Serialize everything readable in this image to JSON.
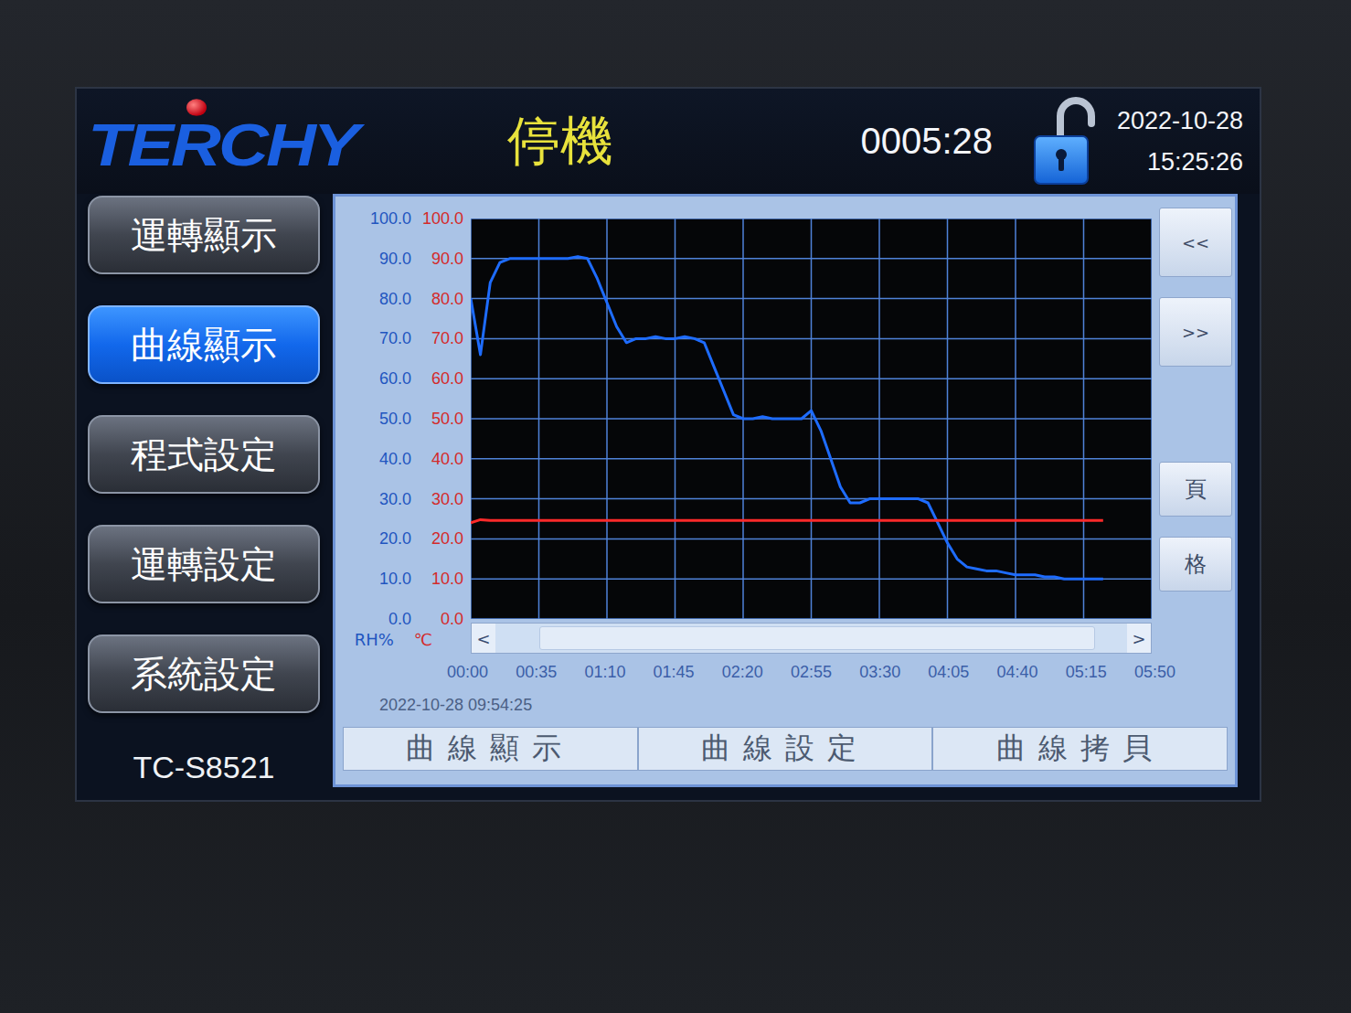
{
  "header": {
    "logo": "TERCHY",
    "status": "停機",
    "timer": "0005:28",
    "lock": {
      "locked": false
    },
    "date": "2022-10-28",
    "time": "15:25:26"
  },
  "sidebar": {
    "items": [
      {
        "label": "運轉顯示",
        "selected": false
      },
      {
        "label": "曲線顯示",
        "selected": true
      },
      {
        "label": "程式設定",
        "selected": false
      },
      {
        "label": "運轉設定",
        "selected": false
      },
      {
        "label": "系統設定",
        "selected": false
      }
    ],
    "model": "TC-S8521"
  },
  "chart": {
    "axes": [
      {
        "unit": "RH%",
        "color": "#1f55c0",
        "ticks": [
          "100.0",
          "90.0",
          "80.0",
          "70.0",
          "60.0",
          "50.0",
          "40.0",
          "30.0",
          "20.0",
          "10.0",
          "0.0"
        ]
      },
      {
        "unit": "℃",
        "color": "#d42a2a",
        "ticks": [
          "100.0",
          "90.0",
          "80.0",
          "70.0",
          "60.0",
          "50.0",
          "40.0",
          "30.0",
          "20.0",
          "10.0",
          "0.0"
        ]
      }
    ],
    "series": [
      {
        "name": "RH%",
        "color": "#1e6cff",
        "values": [
          80,
          66,
          84,
          89,
          90,
          90,
          90,
          90,
          90,
          90,
          90,
          90.5,
          90,
          85,
          79,
          73,
          69,
          70,
          70,
          70.5,
          70,
          70,
          70.5,
          70,
          69,
          63,
          57,
          51,
          50,
          50,
          50.5,
          50,
          50,
          50,
          50,
          52,
          47,
          40,
          33,
          29,
          29,
          30,
          30,
          30,
          30,
          30,
          30,
          29,
          24,
          19,
          15,
          13,
          12.5,
          12,
          12,
          11.5,
          11,
          11,
          11,
          10.5,
          10.5,
          10,
          10,
          10,
          10,
          10
        ]
      },
      {
        "name": "℃",
        "color": "#ff2a2a",
        "values": [
          24,
          24.8,
          24.6,
          24.6,
          24.6,
          24.6,
          24.6,
          24.6,
          24.6,
          24.6,
          24.6,
          24.6,
          24.6,
          24.6,
          24.6,
          24.6,
          24.6,
          24.6,
          24.6,
          24.6,
          24.6,
          24.6,
          24.6,
          24.6,
          24.6,
          24.6,
          24.6,
          24.6,
          24.6,
          24.6,
          24.6,
          24.6,
          24.6,
          24.6,
          24.6,
          24.6,
          24.6,
          24.6,
          24.6,
          24.6,
          24.6,
          24.6,
          24.6,
          24.6,
          24.6,
          24.6,
          24.6,
          24.6,
          24.6,
          24.6,
          24.6,
          24.6,
          24.6,
          24.6,
          24.6,
          24.6,
          24.6,
          24.6,
          24.6,
          24.6,
          24.6,
          24.6,
          24.6,
          24.6,
          24.6,
          24.6
        ]
      }
    ],
    "x_ticks": [
      "00:00",
      "00:35",
      "01:10",
      "01:45",
      "02:20",
      "02:55",
      "03:30",
      "04:05",
      "04:40",
      "05:15",
      "05:50"
    ],
    "start": "2022-10-28 09:54:25",
    "scrollbar": {
      "left": "<",
      "right": ">",
      "thumb_start": 0.07,
      "level": 0.88
    },
    "buttons": [
      "<<",
      ">>",
      "頁",
      "格"
    ]
  },
  "tabs": [
    {
      "label": "曲線顯示",
      "selected": false
    },
    {
      "label": "曲線設定",
      "selected": false
    },
    {
      "label": "曲線拷貝",
      "selected": false
    }
  ]
}
